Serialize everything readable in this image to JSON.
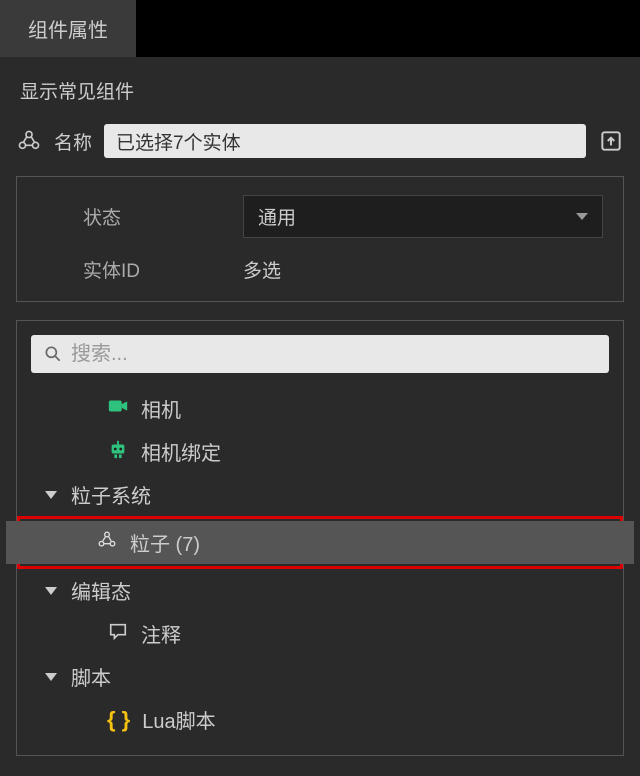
{
  "tab": {
    "title": "组件属性"
  },
  "subtitle": "显示常见组件",
  "nameRow": {
    "label": "名称",
    "value": "已选择7个实体"
  },
  "props": {
    "stateLabel": "状态",
    "stateValue": "通用",
    "entityIdLabel": "实体ID",
    "entityIdValue": "多选"
  },
  "search": {
    "placeholder": "搜索..."
  },
  "tree": {
    "camera": "相机",
    "cameraBind": "相机绑定",
    "particleSystem": "粒子系统",
    "particle": "粒子 (7)",
    "editState": "编辑态",
    "comment": "注释",
    "script": "脚本",
    "lua": "Lua脚本"
  }
}
